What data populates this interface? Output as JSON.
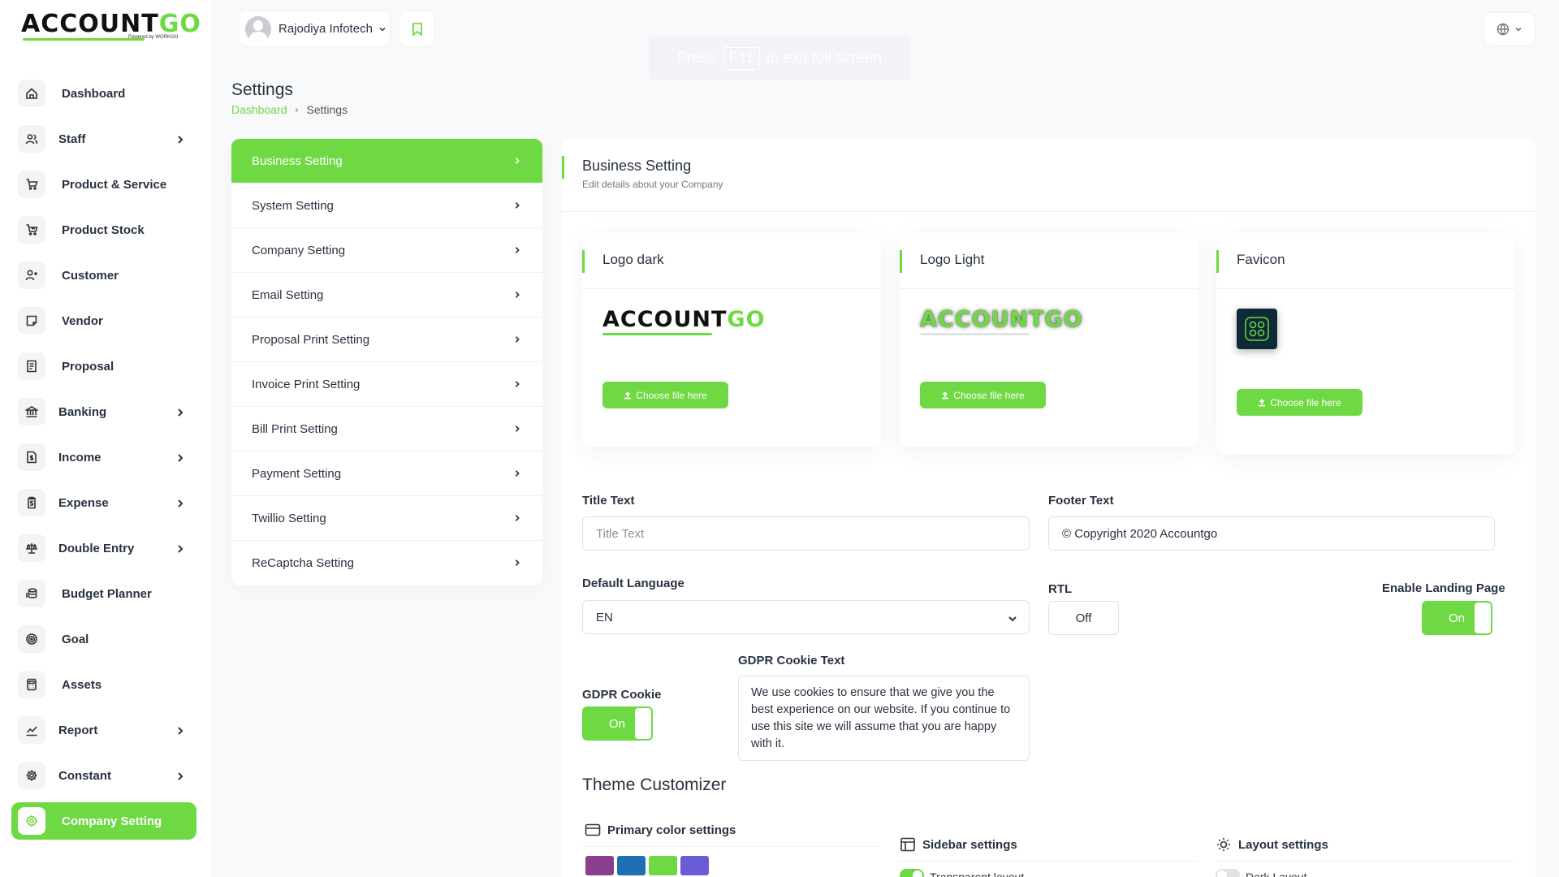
{
  "brand": {
    "logo_main": "ACCOUNT",
    "logo_accent": "GO",
    "tagline": "Powered by WORKGO"
  },
  "header": {
    "user_name": "Rajodiya Infotech",
    "fullscreen_hint": {
      "prefix": "Press",
      "key": "F11",
      "suffix": "to exit full screen"
    }
  },
  "sidebar": {
    "items": [
      {
        "label": "Dashboard",
        "icon": "home-icon",
        "has_children": false
      },
      {
        "label": "Staff",
        "icon": "users-icon",
        "has_children": true
      },
      {
        "label": "Product & Service",
        "icon": "cart-icon",
        "has_children": false
      },
      {
        "label": "Product Stock",
        "icon": "cart-stock-icon",
        "has_children": false
      },
      {
        "label": "Customer",
        "icon": "user-plus-icon",
        "has_children": false
      },
      {
        "label": "Vendor",
        "icon": "note-icon",
        "has_children": false
      },
      {
        "label": "Proposal",
        "icon": "receipt-icon",
        "has_children": false
      },
      {
        "label": "Banking",
        "icon": "bank-icon",
        "has_children": true
      },
      {
        "label": "Income",
        "icon": "file-dollar-icon",
        "has_children": true
      },
      {
        "label": "Expense",
        "icon": "clipboard-icon",
        "has_children": true
      },
      {
        "label": "Double Entry",
        "icon": "scale-icon",
        "has_children": true
      },
      {
        "label": "Budget Planner",
        "icon": "coins-icon",
        "has_children": false
      },
      {
        "label": "Goal",
        "icon": "target-icon",
        "has_children": false
      },
      {
        "label": "Assets",
        "icon": "calculator-icon",
        "has_children": false
      },
      {
        "label": "Report",
        "icon": "chart-line-icon",
        "has_children": true
      },
      {
        "label": "Constant",
        "icon": "gear-icon",
        "has_children": true
      },
      {
        "label": "Company Setting",
        "icon": "settings-icon",
        "has_children": false,
        "active": true
      }
    ]
  },
  "page": {
    "title": "Settings",
    "breadcrumb": {
      "home": "Dashboard",
      "current": "Settings"
    }
  },
  "settings_menu": {
    "items": [
      {
        "label": "Business Setting",
        "active": true
      },
      {
        "label": "System Setting"
      },
      {
        "label": "Company Setting"
      },
      {
        "label": "Email Setting"
      },
      {
        "label": "Proposal Print Setting"
      },
      {
        "label": "Invoice Print Setting"
      },
      {
        "label": "Bill Print Setting"
      },
      {
        "label": "Payment Setting"
      },
      {
        "label": "Twillio Setting"
      },
      {
        "label": "ReCaptcha Setting"
      }
    ]
  },
  "business": {
    "title": "Business Setting",
    "subtitle": "Edit details about your Company",
    "logo_dark": {
      "label": "Logo dark",
      "button": "Choose file here"
    },
    "logo_light": {
      "label": "Logo Light",
      "button": "Choose file here"
    },
    "favicon": {
      "label": "Favicon",
      "button": "Choose file here"
    },
    "title_text": {
      "label": "Title Text",
      "placeholder": "Title Text",
      "value": ""
    },
    "footer_text": {
      "label": "Footer Text",
      "value": "© Copyright 2020 Accountgo"
    },
    "default_language": {
      "label": "Default Language",
      "value": "EN"
    },
    "rtl": {
      "label": "RTL",
      "value": "Off"
    },
    "landing_page": {
      "label": "Enable Landing Page",
      "value": "On"
    },
    "gdpr_cookie": {
      "label": "GDPR Cookie",
      "value": "On"
    },
    "gdpr_text": {
      "label": "GDPR Cookie Text",
      "value": "We use cookies to ensure that we give you the best experience on our website. If you continue to use this site we will assume that you are happy with it."
    }
  },
  "theme": {
    "title": "Theme Customizer",
    "primary_color": {
      "label": "Primary color settings",
      "swatches": [
        "#8a3e8f",
        "#1f6fb5",
        "#6fd943",
        "#6a5bd6"
      ]
    },
    "sidebar": {
      "label": "Sidebar settings",
      "option": "Transparent layout",
      "option_on": true
    },
    "layout": {
      "label": "Layout settings",
      "option": "Dark Layout",
      "option_on": false
    }
  }
}
